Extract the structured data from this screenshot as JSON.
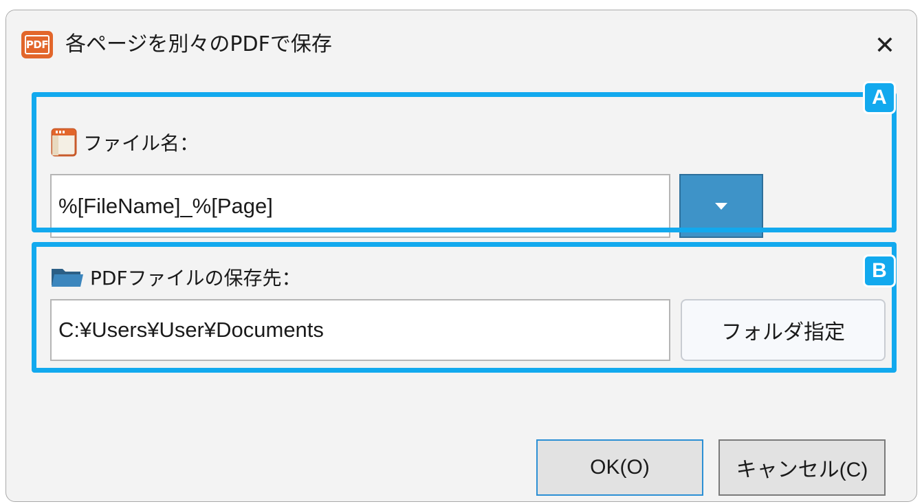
{
  "window": {
    "title": "各ページを別々のPDFで保存",
    "icon_text": "PDF",
    "close_glyph": "✕"
  },
  "section_a": {
    "badge": "A",
    "label": "ファイル名：",
    "filename_value": "%[FileName]_%[Page]"
  },
  "section_b": {
    "badge": "B",
    "label": "PDFファイルの保存先：",
    "path_value": "C:¥Users¥User¥Documents",
    "folder_button_label": "フォルダ指定"
  },
  "footer": {
    "ok_label": "OK(O)",
    "cancel_label": "キャンセル(C)"
  },
  "icons": {
    "app": "pdf-icon",
    "filename": "file-icon",
    "destination": "folder-icon",
    "dropdown": "caret-down-icon",
    "close": "close-icon"
  },
  "colors": {
    "highlight": "#12a9ee",
    "dropdown_bg": "#3e93c8",
    "pdf_orange": "#e2662b",
    "dialog_bg": "#f3f3f3"
  }
}
